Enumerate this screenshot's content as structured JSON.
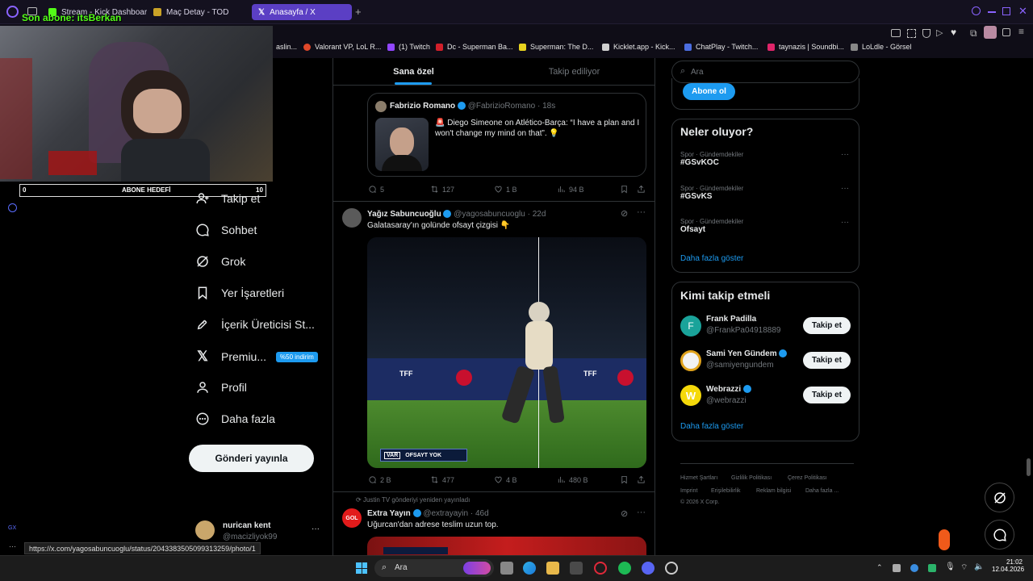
{
  "browser": {
    "tabs": [
      {
        "label": "Stream - Kick Dashboard",
        "color": "#53fc18"
      },
      {
        "label": "Maç Detay - TOD",
        "color": "#c9a227"
      },
      {
        "label": "Anasayfa / X",
        "color": "#ffffff",
        "active": true
      }
    ],
    "bookmarks": [
      "aslin...",
      "Valorant VP, LoL R...",
      "(1) Twitch",
      "Dc - Superman Ba...",
      "Superman: The D...",
      "Kicklet.app - Kick...",
      "ChatPlay - Twitch...",
      "taynazis | Soundbi...",
      "LoLdle - Görsel"
    ],
    "status_url": "https://x.com/yagosabuncuoglu/status/2043383505099313259/photo/1"
  },
  "overlay": {
    "sub_text": "Son abone: itsBerkan",
    "goal_label": "ABONE HEDEFİ",
    "goal_current": "0",
    "goal_target": "10",
    "progress_fraction": 0.0
  },
  "nav": {
    "items": [
      {
        "label": "Takip et",
        "icon": "person-add-icon"
      },
      {
        "label": "Sohbet",
        "icon": "chat-icon"
      },
      {
        "label": "Grok",
        "icon": "grok-icon"
      },
      {
        "label": "Yer İşaretleri",
        "icon": "bookmark-icon"
      },
      {
        "label": "İçerik Üreticisi St...",
        "icon": "rocket-icon"
      },
      {
        "label": "Premiu...",
        "icon": "x-logo-icon",
        "badge": "%50 indirim"
      },
      {
        "label": "Profil",
        "icon": "person-icon"
      },
      {
        "label": "Daha fazla",
        "icon": "more-circle-icon"
      }
    ],
    "post_button": "Gönderi yayınla",
    "account": {
      "name": "nurican kent",
      "handle": "@macizliyok99"
    }
  },
  "feed": {
    "tabs": [
      "Sana özel",
      "Takip ediliyor"
    ],
    "tweet1": {
      "quoted": {
        "name": "Fabrizio Romano",
        "handle": "@FabrizioRomano",
        "time": "18s",
        "text": "🚨 Diego Simeone on Atlético-Barça: “I have a plan and I won't change my mind on that”. 💡"
      },
      "stats": {
        "replies": "5",
        "reposts": "127",
        "likes": "1 B",
        "views": "94 B"
      }
    },
    "tweet2": {
      "name": "Yağız Sabuncuoğlu",
      "handle": "@yagosabuncuoglu",
      "time": "22d",
      "text": "Galatasaray'ın golünde ofsayt çizgisi 👇",
      "media_caption": "OFSAYT YOK",
      "media_var": "VAR",
      "banner_text": "TFF",
      "stats": {
        "replies": "2 B",
        "reposts": "477",
        "likes": "4 B",
        "views": "480 B"
      }
    },
    "tweet3": {
      "repost_label": "Justin TV gönderiyi yeniden yayınladı",
      "name": "Extra Yayın",
      "handle": "@extrayayin",
      "time": "46d",
      "text": "Uğurcan'dan adrese teslim uzun top.",
      "avatar_text": "GOL"
    }
  },
  "right": {
    "search_placeholder": "Ara",
    "subscribe_button": "Abone ol",
    "trends_title": "Neler oluyor?",
    "trends": [
      {
        "meta": "Spor · Gündemdekiler",
        "name": "#GSvKOC"
      },
      {
        "meta": "Spor · Gündemdekiler",
        "name": "#GSvKS"
      },
      {
        "meta": "Spor · Gündemdekiler",
        "name": "Ofsayt"
      }
    ],
    "show_more": "Daha fazla göster",
    "who_title": "Kimi takip etmeli",
    "who": [
      {
        "name": "Frank Padilla",
        "handle": "@FrankPa04918889",
        "initial": "F",
        "color": "#1aa39a",
        "verified": false
      },
      {
        "name": "Sami Yen Gündem",
        "handle": "@samiyengundem",
        "initial": "",
        "color": "#f2f2f2",
        "verified": true
      },
      {
        "name": "Webrazzi",
        "handle": "@webrazzi",
        "initial": "W",
        "color": "#f5d90a",
        "verified": true
      }
    ],
    "follow_label": "Takip et",
    "footer": [
      "Hizmet Şartları",
      "Gizlilik Politikası",
      "Çerez Politikası",
      "Imprint",
      "Erişilebilirlik",
      "Reklam bilgisi",
      "Daha fazla ...",
      "© 2026 X Corp."
    ]
  },
  "taskbar": {
    "search": "Ara",
    "time": "21:02",
    "date": "12.04.2026"
  }
}
